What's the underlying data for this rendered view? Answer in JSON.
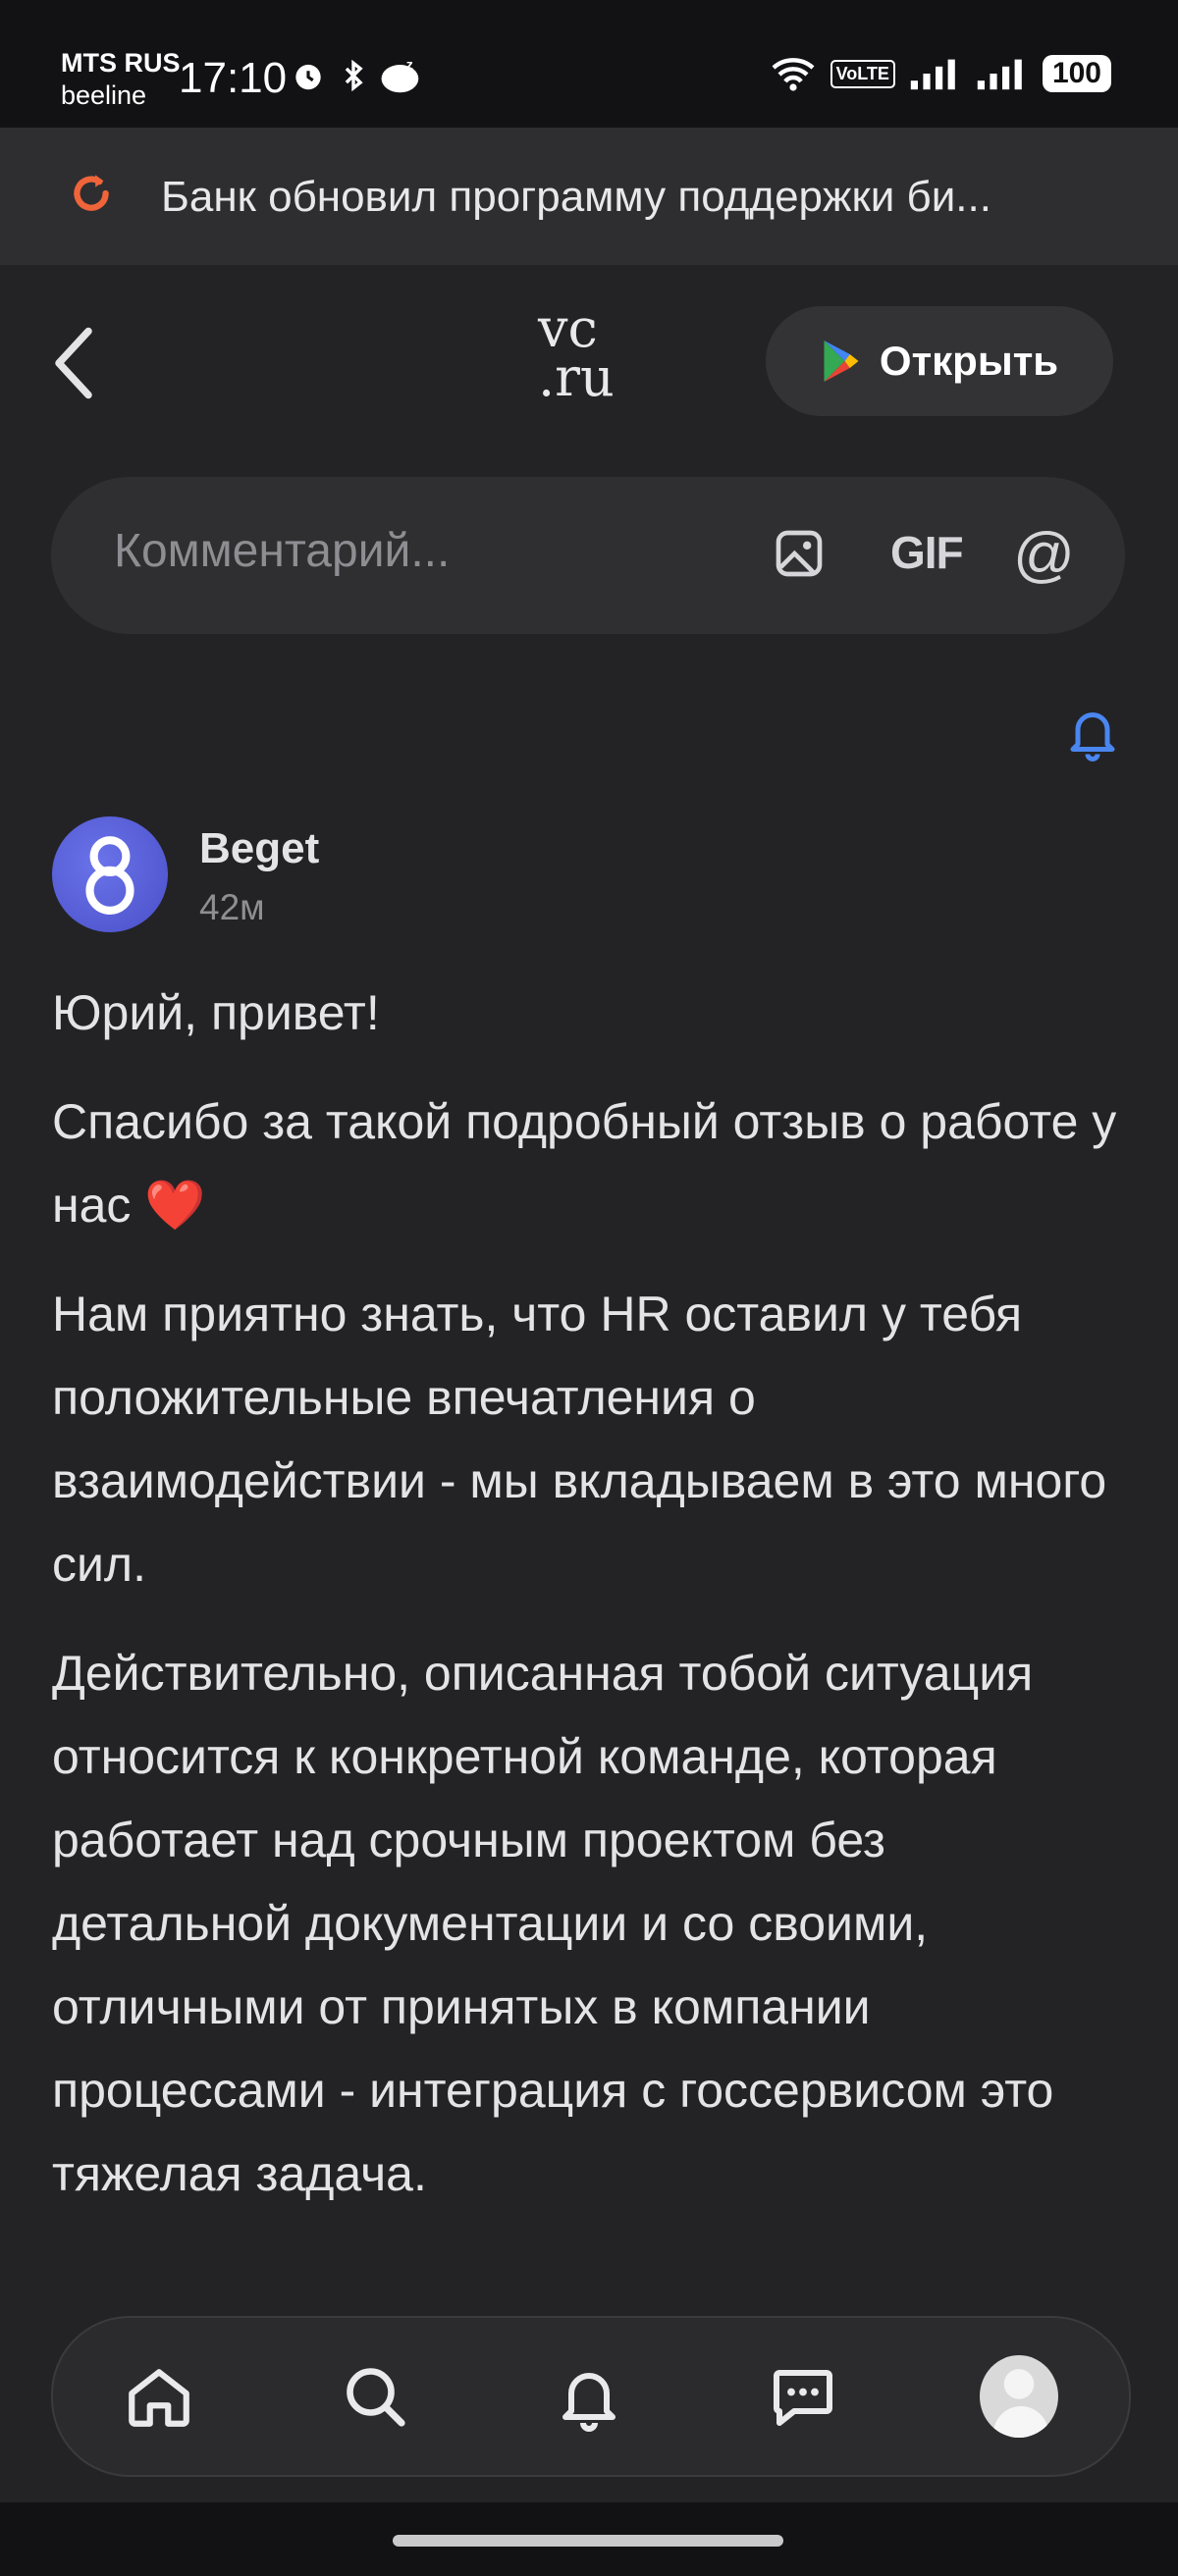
{
  "status_bar": {
    "carrier_1": "MTS RUS",
    "carrier_2": "beeline",
    "time": "17:10",
    "volte": "VoLTE",
    "battery": "100"
  },
  "banner": {
    "icon": "refresh-icon",
    "text": "Банк обновил программу поддержки би..."
  },
  "header": {
    "logo_line1": "vc",
    "logo_line2": ".ru",
    "open_button": "Открыть",
    "open_icon": "google-play-icon"
  },
  "comment_box": {
    "placeholder": "Комментарий...",
    "gif_label": "GIF",
    "mention_label": "@"
  },
  "comment": {
    "author": "Beget",
    "time": "42м",
    "paragraphs": [
      "Юрий, привет!",
      "Спасибо за такой подробный отзыв о работе у нас ❤️",
      "Нам приятно знать, что HR оставил у тебя положительные впечатления о взаимодействии - мы вкладываем в это много сил.",
      "Действительно, описанная тобой ситуация относится к конкретной команде, которая работает над срочным проектом без детальной документации и со своими, отличными от принятых в компании процессами - интеграция с госсервисом это тяжелая задача."
    ]
  },
  "bottom_nav": {
    "items": [
      "home-icon",
      "search-icon",
      "bell-icon",
      "messages-icon",
      "profile-avatar"
    ]
  },
  "colors": {
    "background": "#232325",
    "accent_blue": "#4a86f0",
    "banner_orange": "#f0643a"
  }
}
